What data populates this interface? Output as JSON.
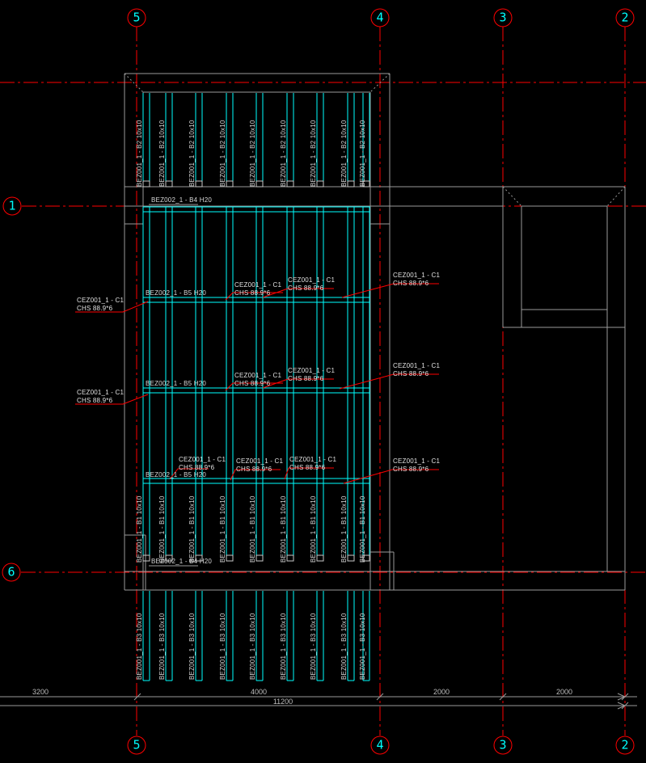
{
  "grid": {
    "top": [
      "5",
      "4",
      "3",
      "2"
    ],
    "bottom": [
      "5",
      "4",
      "3",
      "2"
    ],
    "side": [
      "1",
      "6"
    ]
  },
  "beams": {
    "top": {
      "label": "BEZ001_1 - B2 10x10",
      "count": 9
    },
    "middle": {
      "label": "BEZ001_1 - B1 10x10",
      "count": 9
    },
    "bottom": {
      "label": "BEZ001_1 - B3 10x10",
      "count": 9
    }
  },
  "bands": {
    "b4": "BEZ002_1 - B4 H20",
    "b5": "BEZ002_1 - B5 H20"
  },
  "column_label": {
    "line1": "CEZ001_1 - C1",
    "line2": "CHS 88.9*6"
  },
  "dimensions": {
    "segments": [
      "3200",
      "4000",
      "2000",
      "2000"
    ],
    "total": "11200"
  },
  "colors": {
    "background": "#000000",
    "grid_red": "#ff0000",
    "beam_cyan": "#00ffff",
    "structure_gray": "#9a9a9a",
    "label_text": "#d8d8d8",
    "bubble_number": "#00ffff"
  }
}
